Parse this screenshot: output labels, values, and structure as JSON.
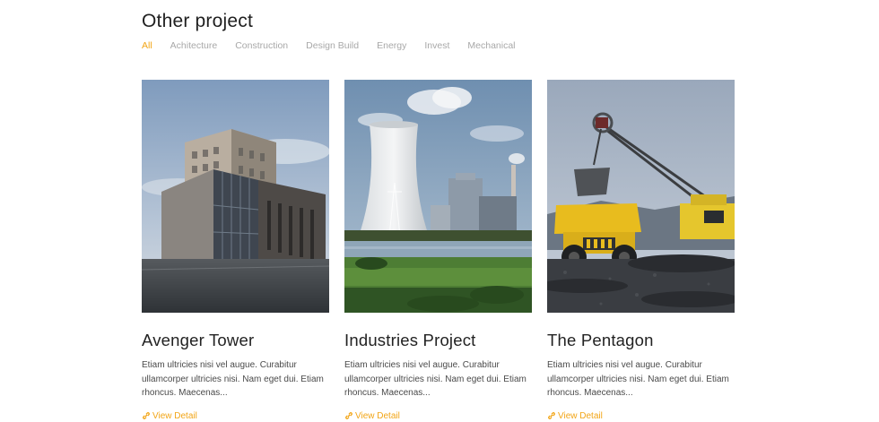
{
  "section": {
    "title": "Other project"
  },
  "filters": [
    {
      "label": "All",
      "active": true
    },
    {
      "label": "Achitecture",
      "active": false
    },
    {
      "label": "Construction",
      "active": false
    },
    {
      "label": "Design Build",
      "active": false
    },
    {
      "label": "Energy",
      "active": false
    },
    {
      "label": "Invest",
      "active": false
    },
    {
      "label": "Mechanical",
      "active": false
    }
  ],
  "projects": [
    {
      "title": "Avenger Tower",
      "description": "Etiam ultricies nisi vel augue. Curabitur ullamcorper ultricies nisi. Nam eget dui. Etiam rhoncus. Maecenas...",
      "link_label": "View Detail",
      "image_icon": "building-photo"
    },
    {
      "title": "Industries Project",
      "description": "Etiam ultricies nisi vel augue. Curabitur ullamcorper ultricies nisi. Nam eget dui. Etiam rhoncus. Maecenas...",
      "link_label": "View Detail",
      "image_icon": "cooling-tower-photo"
    },
    {
      "title": "The Pentagon",
      "description": "Etiam ultricies nisi vel augue. Curabitur ullamcorper ultricies nisi. Nam eget dui. Etiam rhoncus. Maecenas...",
      "link_label": "View Detail",
      "image_icon": "mining-truck-photo"
    }
  ],
  "colors": {
    "accent": "#f2a516",
    "muted": "#a8a8a8",
    "heading": "#222222",
    "body": "#4a4a4a"
  }
}
